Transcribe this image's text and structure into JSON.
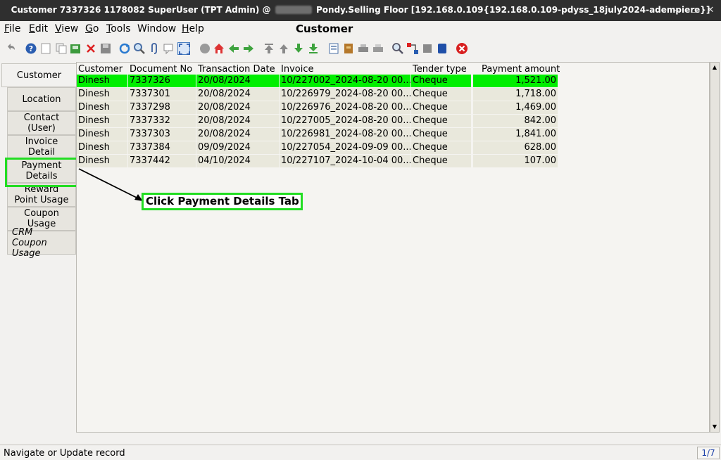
{
  "window": {
    "title_left": "Customer  7337326  1178082  SuperUser (TPT Admin) @",
    "title_right": "Pondy.Selling Floor [192.168.0.109{192.168.0.109-pdyss_18july2024-adempiere}]",
    "minimize": "–",
    "maximize": "▫",
    "close": "✕"
  },
  "menu": {
    "items": [
      {
        "u": "F",
        "rest": "ile"
      },
      {
        "u": "E",
        "rest": "dit"
      },
      {
        "u": "V",
        "rest": "iew"
      },
      {
        "u": "G",
        "rest": "o"
      },
      {
        "u": "T",
        "rest": "ools"
      },
      {
        "pre": "",
        "u": "",
        "rest": "Window"
      },
      {
        "u": "H",
        "rest": "elp"
      }
    ],
    "window_title": "Customer"
  },
  "toolbar": {
    "icons": [
      "undo-icon",
      "help-icon",
      "new-icon",
      "copy-icon",
      "save-copy-icon",
      "delete-icon",
      "save-icon",
      "refresh-icon",
      "find-icon",
      "attachment-icon",
      "chat-icon",
      "fullscreen-icon",
      "history-icon",
      "home-icon",
      "previous-icon",
      "next-icon",
      "first-record-icon",
      "previous-record-icon",
      "next-record-icon",
      "last-record-icon",
      "report-icon",
      "archive-icon",
      "print-preview-icon",
      "print-icon",
      "zoom-across-icon",
      "workflow-icon",
      "request-icon",
      "product-info-icon",
      "exit-icon"
    ]
  },
  "tabs": [
    {
      "line1": "Customer",
      "line2": ""
    },
    {
      "line1": "Location",
      "line2": ""
    },
    {
      "line1": "Contact",
      "line2": "(User)"
    },
    {
      "line1": "Invoice",
      "line2": "Detail"
    },
    {
      "line1": "Payment",
      "line2": "Details"
    },
    {
      "line1": "Reward",
      "line2": "Point Usage"
    },
    {
      "line1": "Coupon",
      "line2": "Usage"
    },
    {
      "line1": "CRM",
      "line2": "Coupon Usage"
    }
  ],
  "grid": {
    "columns": [
      "Customer",
      "Document No",
      "Transaction Date",
      "Invoice",
      "Tender type",
      "Payment amount"
    ],
    "rows": [
      [
        "Dinesh",
        "7337326",
        "20/08/2024",
        "10/227002_2024-08-20 00...",
        "Cheque",
        "1,521.00"
      ],
      [
        "Dinesh",
        "7337301",
        "20/08/2024",
        "10/226979_2024-08-20 00...",
        "Cheque",
        "1,718.00"
      ],
      [
        "Dinesh",
        "7337298",
        "20/08/2024",
        "10/226976_2024-08-20 00...",
        "Cheque",
        "1,469.00"
      ],
      [
        "Dinesh",
        "7337332",
        "20/08/2024",
        "10/227005_2024-08-20 00...",
        "Cheque",
        "842.00"
      ],
      [
        "Dinesh",
        "7337303",
        "20/08/2024",
        "10/226981_2024-08-20 00...",
        "Cheque",
        "1,841.00"
      ],
      [
        "Dinesh",
        "7337384",
        "09/09/2024",
        "10/227054_2024-09-09 00...",
        "Cheque",
        "628.00"
      ],
      [
        "Dinesh",
        "7337442",
        "04/10/2024",
        "10/227107_2024-10-04 00...",
        "Cheque",
        "107.00"
      ]
    ]
  },
  "callout": {
    "text": "Click Payment Details Tab"
  },
  "status": {
    "message": "Navigate or Update record",
    "record_count": "1/7"
  },
  "colors": {
    "highlight": "#22dd22",
    "selected_row": "#00ee00",
    "titlebar": "#2f2f2f"
  }
}
